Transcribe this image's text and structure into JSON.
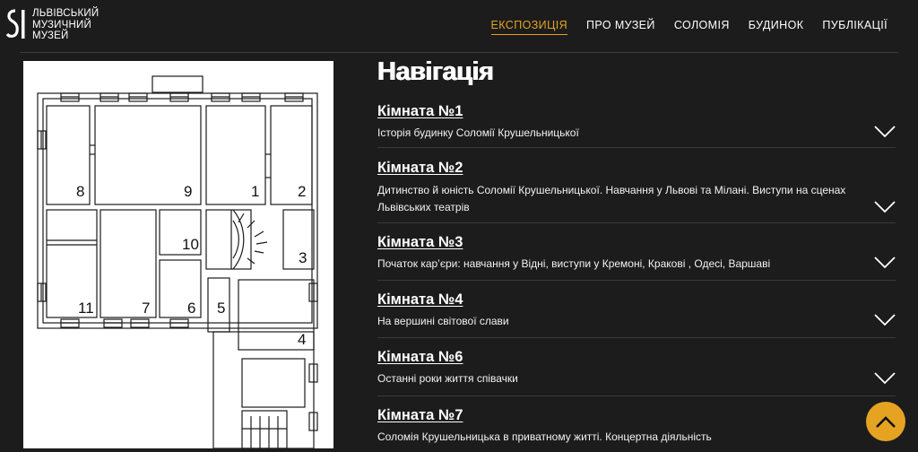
{
  "header": {
    "logo_lines": [
      "ЛЬВІВСЬКИЙ",
      "МУЗИЧНИЙ",
      "МУЗЕЙ"
    ],
    "nav": [
      {
        "label": "ЕКСПОЗИЦІЯ",
        "active": true
      },
      {
        "label": "ПРО МУЗЕЙ",
        "active": false
      },
      {
        "label": "СОЛОМІЯ",
        "active": false
      },
      {
        "label": "БУДИНОК",
        "active": false
      },
      {
        "label": "ПУБЛІКАЦІЇ",
        "active": false
      }
    ]
  },
  "plan": {
    "room_numbers": [
      "1",
      "2",
      "3",
      "4",
      "5",
      "6",
      "7",
      "8",
      "9",
      "10",
      "11"
    ]
  },
  "main": {
    "title": "Навігація",
    "rooms": [
      {
        "title": "Кімната №1",
        "description": "Історія будинку Соломії Крушельницької"
      },
      {
        "title": "Кімната №2",
        "description": "Дитинство й юність Соломії Крушельницької. Навчання у Львові та Мілані. Виступи на сценах Львівських театрів"
      },
      {
        "title": "Кімната №3",
        "description": "Початок кар’єри: навчання у Відні, виступи у Кремоні, Кракові , Одесі, Варшаві"
      },
      {
        "title": "Кімната №4",
        "description": "На вершині світової слави"
      },
      {
        "title": "Кімната №6",
        "description": "Останні роки життя співачки"
      },
      {
        "title": "Кімната №7",
        "description": "Соломія Крушельницька в приватному житті. Концертна діяльність"
      }
    ]
  },
  "colors": {
    "background": "#1c1c1c",
    "accent": "#e5a321",
    "text": "#ffffff"
  },
  "icons": {
    "expand": "chevron-down-icon",
    "scroll_top": "chevron-up-icon"
  }
}
